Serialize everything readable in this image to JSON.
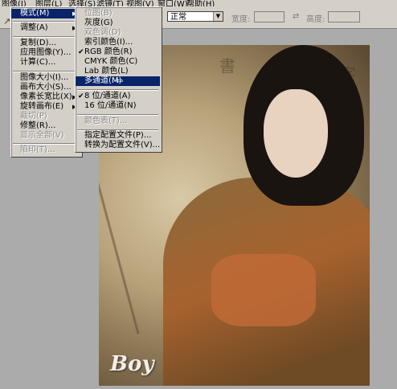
{
  "menubar": {
    "items": [
      "图像(I)",
      "图层(L)",
      "选择(S)",
      "滤镜(T)",
      "视图(V)",
      "窗口(W)",
      "帮助(H)"
    ]
  },
  "options_bar": {
    "blend_mode": "正常",
    "width_label": "宽度:",
    "height_label": "高度:"
  },
  "image_menu": {
    "items": [
      {
        "label": "模式(M)",
        "submenu": true,
        "highlighted": true
      },
      {
        "separator": true
      },
      {
        "label": "调整(A)",
        "submenu": true
      },
      {
        "separator": true
      },
      {
        "label": "复制(D)..."
      },
      {
        "label": "应用图像(Y)..."
      },
      {
        "label": "计算(C)..."
      },
      {
        "separator": true
      },
      {
        "label": "图像大小(I)..."
      },
      {
        "label": "画布大小(S)..."
      },
      {
        "label": "像素长宽比(X)",
        "submenu": true
      },
      {
        "label": "旋转画布(E)",
        "submenu": true
      },
      {
        "label": "裁切(P)",
        "disabled": true
      },
      {
        "label": "修整(R)..."
      },
      {
        "label": "显示全部(V)",
        "disabled": true
      },
      {
        "separator": true
      },
      {
        "label": "陷印(T)...",
        "disabled": true
      }
    ]
  },
  "mode_submenu": {
    "items": [
      {
        "label": "位图(B)",
        "disabled": true
      },
      {
        "label": "灰度(G)"
      },
      {
        "label": "双色调(D)",
        "disabled": true
      },
      {
        "label": "索引颜色(I)..."
      },
      {
        "label": "RGB 颜色(R)",
        "checked": true
      },
      {
        "label": "CMYK 颜色(C)"
      },
      {
        "label": "Lab 颜色(L)"
      },
      {
        "label": "多通道(M)",
        "highlighted": true
      },
      {
        "separator": true
      },
      {
        "label": "8 位/通道(A)",
        "checked": true
      },
      {
        "label": "16 位/通道(N)"
      },
      {
        "separator": true
      },
      {
        "label": "颜色表(T)...",
        "disabled": true
      },
      {
        "separator": true
      },
      {
        "label": "指定配置文件(P)..."
      },
      {
        "label": "转换为配置文件(V)..."
      }
    ]
  },
  "photo": {
    "logo_text": "Boy"
  },
  "colors": {
    "menu_bg": "#d4d0c8",
    "highlight": "#0a246a",
    "workspace": "#acabab"
  }
}
